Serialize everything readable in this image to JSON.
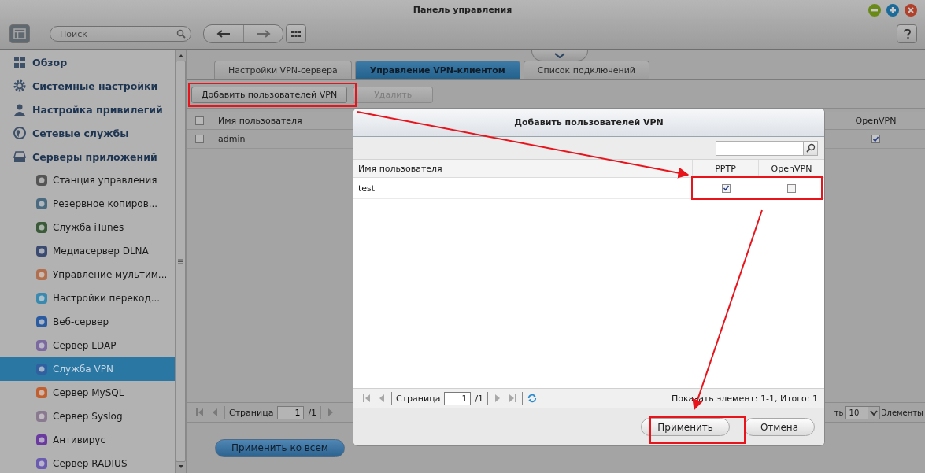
{
  "window": {
    "title": "Панель управления",
    "search": {
      "placeholder": "Поиск"
    }
  },
  "sidebar": {
    "items": [
      {
        "label": "Обзор",
        "selected": false
      },
      {
        "label": "Системные настройки",
        "selected": false
      },
      {
        "label": "Настройка привилегий",
        "selected": false
      },
      {
        "label": "Сетевые службы",
        "selected": false
      },
      {
        "label": "Серверы приложений",
        "selected": false,
        "children": [
          {
            "label": "Станция управления",
            "selected": false
          },
          {
            "label": "Резервное копиров...",
            "selected": false
          },
          {
            "label": "Служба iTunes",
            "selected": false
          },
          {
            "label": "Медиасервер DLNA",
            "selected": false
          },
          {
            "label": "Управление мультим...",
            "selected": false
          },
          {
            "label": "Настройки перекод...",
            "selected": false
          },
          {
            "label": "Веб-сервер",
            "selected": false
          },
          {
            "label": "Сервер LDAP",
            "selected": false
          },
          {
            "label": "Служба VPN",
            "selected": true
          },
          {
            "label": "Сервер MySQL",
            "selected": false
          },
          {
            "label": "Сервер Syslog",
            "selected": false
          },
          {
            "label": "Антивирус",
            "selected": false
          },
          {
            "label": "Сервер RADIUS",
            "selected": false
          }
        ]
      }
    ]
  },
  "tabs": [
    {
      "label": "Настройки VPN-сервера",
      "selected": false
    },
    {
      "label": "Управление VPN-клиентом",
      "selected": true
    },
    {
      "label": "Список подключений",
      "selected": false
    }
  ],
  "toolbar": {
    "buttons": [
      {
        "label": "Добавить пользователей VPN",
        "disabled": false
      },
      {
        "label": "Удалить",
        "disabled": true
      }
    ]
  },
  "table": {
    "header_checked": false,
    "columns": [
      "Имя пользователя",
      "OpenVPN"
    ],
    "rows": [
      {
        "checked": false,
        "name": "admin",
        "openvpn": true
      }
    ]
  },
  "pager": {
    "page_label": "Страница",
    "page": "1",
    "total": "/1",
    "page_size_label": "ть",
    "page_size": "10",
    "items_label": "Элементы"
  },
  "apply_all_button": "Применить ко всем",
  "dialog": {
    "title": "Добавить пользователей VPN",
    "columns": [
      "Имя пользователя",
      "PPTP",
      "OpenVPN"
    ],
    "rows": [
      {
        "name": "test",
        "pptp": true,
        "openvpn": false
      }
    ],
    "pager": {
      "page_label": "Страница",
      "page": "1",
      "total": "/1",
      "summary": "Показать элемент: 1-1, Итого: 1"
    },
    "buttons": [
      "Применить",
      "Отмена"
    ]
  }
}
